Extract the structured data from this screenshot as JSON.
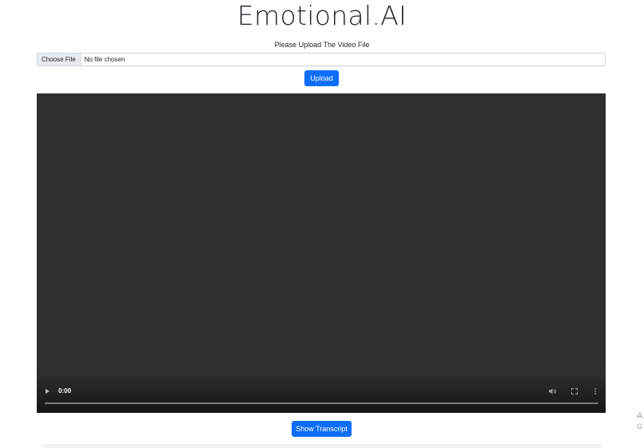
{
  "header": {
    "title": "Emotional.AI"
  },
  "upload": {
    "prompt": "Please Upload The Video File",
    "file_button_label": "Choose File",
    "file_status": "No file chosen",
    "upload_button_label": "Upload"
  },
  "video_player": {
    "current_time": "0:00",
    "progress": 0,
    "controls": {
      "play_icon": "play-icon",
      "volume_icon": "volume-icon",
      "fullscreen_icon": "fullscreen-icon",
      "more_icon": "more-options-icon"
    }
  },
  "transcript": {
    "button_label": "Show Transcript"
  },
  "edge_fragments": {
    "line1": "A",
    "line2": "G"
  },
  "colors": {
    "primary": "#0d6efd",
    "video_background": "#2f2f2f"
  }
}
